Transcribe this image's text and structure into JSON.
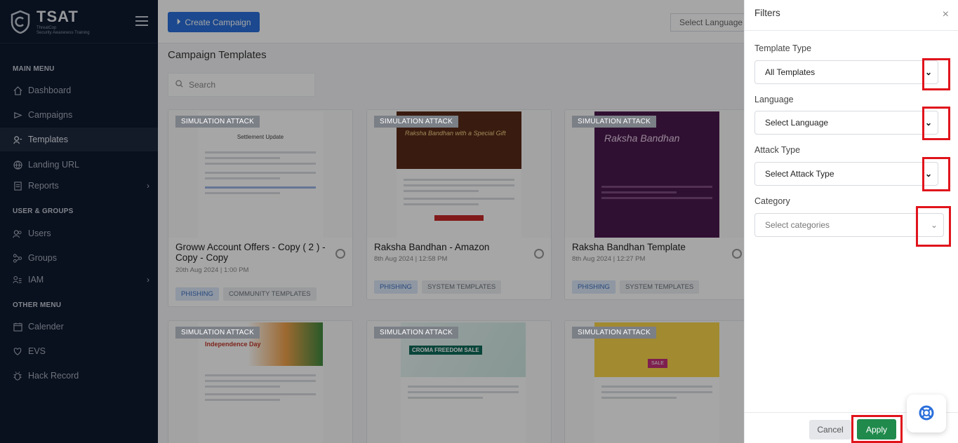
{
  "sidebar": {
    "brand_title": "TSAT",
    "brand_sub_1": "ThreatCop",
    "brand_sub_2": "Security Awareness Training",
    "sections": [
      "MAIN MENU",
      "USER & GROUPS",
      "OTHER MENU"
    ],
    "items": [
      {
        "label": "Dashboard",
        "icon": "home-icon"
      },
      {
        "label": "Campaigns",
        "icon": "campaign-icon"
      },
      {
        "label": "Templates",
        "icon": "templates-icon"
      },
      {
        "label": "Landing URL",
        "icon": "globe-icon"
      },
      {
        "label": "Reports",
        "icon": "reports-icon"
      },
      {
        "label": "Users",
        "icon": "users-icon"
      },
      {
        "label": "Groups",
        "icon": "groups-icon"
      },
      {
        "label": "IAM",
        "icon": "iam-icon"
      },
      {
        "label": "Calender",
        "icon": "calendar-icon"
      },
      {
        "label": "EVS",
        "icon": "evs-icon"
      },
      {
        "label": "Hack Record",
        "icon": "hack-record-icon"
      }
    ]
  },
  "topbar": {
    "create_label": "Create Campaign",
    "language_placeholder": "Select Language"
  },
  "main": {
    "title": "Campaign Templates",
    "search_placeholder": "Search"
  },
  "cards": [
    {
      "badge": "SIMULATION ATTACK",
      "title": "Groww Account Offers - Copy ( 2 ) - Copy - Copy",
      "date": "20th Aug 2024 | 1:00 PM",
      "tags": [
        "PHISHING",
        "COMMUNITY TEMPLATES"
      ],
      "thumb_heading": "Settlement Update"
    },
    {
      "badge": "SIMULATION ATTACK",
      "title": "Raksha Bandhan - Amazon",
      "date": "8th Aug 2024 | 12:58 PM",
      "tags": [
        "PHISHING",
        "SYSTEM TEMPLATES"
      ],
      "thumb_heading": "Raksha Bandhan with a Special Gift"
    },
    {
      "badge": "SIMULATION ATTACK",
      "title": "Raksha Bandhan Template",
      "date": "8th Aug 2024 | 12:27 PM",
      "tags": [
        "PHISHING",
        "SYSTEM TEMPLATES"
      ],
      "thumb_heading": "Raksha Bandhan"
    },
    {
      "badge": "SIMULATION ATTACK",
      "title": "",
      "date": "",
      "tags": [],
      "thumb_heading": "Independence Day"
    },
    {
      "badge": "SIMULATION ATTACK",
      "title": "",
      "date": "",
      "tags": [],
      "thumb_heading": "CROMA FREEDOM SALE"
    },
    {
      "badge": "SIMULATION ATTACK",
      "title": "",
      "date": "",
      "tags": [],
      "thumb_heading": "SALE"
    }
  ],
  "filters": {
    "title": "Filters",
    "close_label": "×",
    "template_type_label": "Template Type",
    "template_type_value": "All Templates",
    "language_label": "Language",
    "language_value": "Select Language",
    "attack_type_label": "Attack Type",
    "attack_type_value": "Select Attack Type",
    "category_label": "Category",
    "category_placeholder": "Select categories",
    "cancel_label": "Cancel",
    "apply_label": "Apply"
  },
  "colors": {
    "sidebar_bg": "#0f1a2e",
    "primary": "#2a6fdb",
    "apply": "#1f8a4c",
    "highlight": "#e0141c"
  }
}
